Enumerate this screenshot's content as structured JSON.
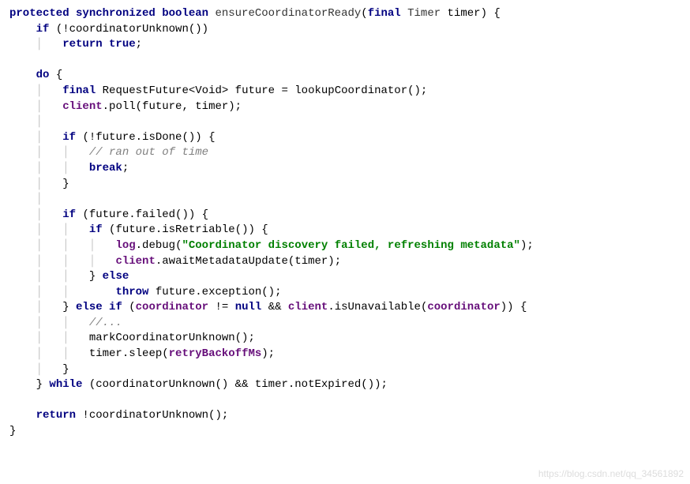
{
  "signature": {
    "modifiers": "protected synchronized boolean",
    "name": "ensureCoordinatorReady",
    "paramKeyword": "final",
    "paramType": "Timer",
    "paramName": "timer"
  },
  "line_ifNotUnknown": "if",
  "line_notCoordinatorUnknown": "(!coordinatorUnknown())",
  "line_returnTrue_kw": "return true",
  "line_returnTrue_semi": ";",
  "do_kw": "do",
  "final_kw": "final",
  "reqFutureType": "RequestFuture<Void> future = lookupCoordinator();",
  "client_field": "client",
  "pollCall": ".poll(future, timer);",
  "if_kw": "if",
  "notDone": "(!future.isDone()) {",
  "ranOutComment": "// ran out of time",
  "break_kw": "break",
  "break_semi": ";",
  "closeBrace": "}",
  "failedCond": "(future.failed()) {",
  "isRetriableCond": "(future.isRetriable()) {",
  "log_field": "log",
  "debugCall": ".debug(",
  "debugString": "\"Coordinator discovery failed, refreshing metadata\"",
  "debugClose": ");",
  "awaitCall": ".awaitMetadataUpdate(timer);",
  "else_kw": "else",
  "closeElse": "} ",
  "throw_kw": "throw",
  "throwCall": " future.exception();",
  "elseif_closebrace": "} ",
  "elseif_kw": "else if",
  "coordinatorField": "coordinator",
  "neqNull": " != ",
  "null_kw": "null",
  "andOp": " && ",
  "isUnavailable": ".isUnavailable(",
  "closeParen": ")) {",
  "dotsComment": "//...",
  "markUnknownCall": "markCoordinatorUnknown();",
  "timerSleep": "timer.sleep(",
  "retryBackoff": "retryBackoffMs",
  "sleepClose": ");",
  "while_kw": "while",
  "whileCond": " (coordinatorUnknown() && timer.notExpired());",
  "return_kw": "return",
  "returnExpr": " !coordinatorUnknown();",
  "watermark": "https://blog.csdn.net/qq_34561892"
}
